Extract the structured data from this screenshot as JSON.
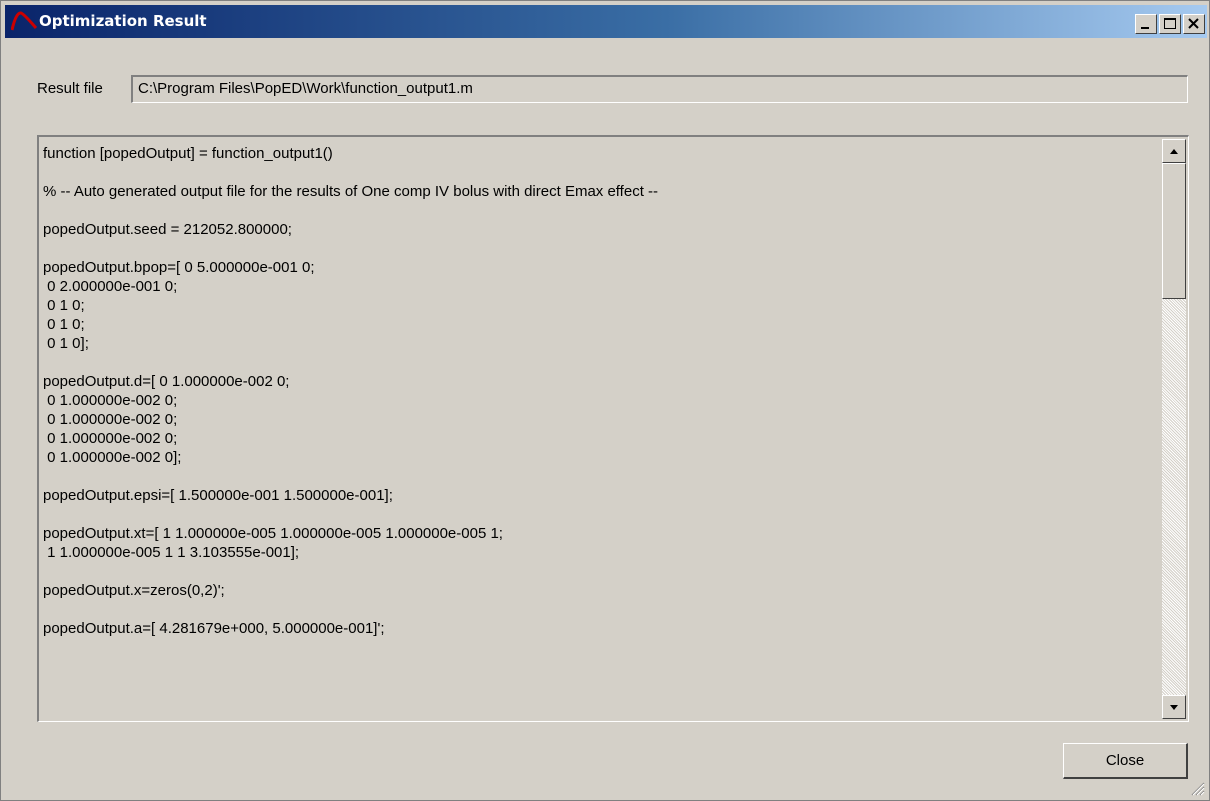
{
  "window": {
    "title": "Optimization Result",
    "controls": [
      "minimize-icon",
      "maximize-icon",
      "close-icon"
    ]
  },
  "result_file": {
    "label": "Result file",
    "value": "C:\\Program Files\\PopED\\Work\\function_output1.m"
  },
  "output_lines": [
    "function [popedOutput] = function_output1()",
    "",
    "% -- Auto generated output file for the results of One comp IV bolus with direct Emax effect --",
    "",
    "popedOutput.seed = 212052.800000;",
    "",
    "popedOutput.bpop=[ 0 5.000000e-001 0;",
    " 0 2.000000e-001 0;",
    " 0 1 0;",
    " 0 1 0;",
    " 0 1 0];",
    "",
    "popedOutput.d=[ 0 1.000000e-002 0;",
    " 0 1.000000e-002 0;",
    " 0 1.000000e-002 0;",
    " 0 1.000000e-002 0;",
    " 0 1.000000e-002 0];",
    "",
    "popedOutput.epsi=[ 1.500000e-001 1.500000e-001];",
    "",
    "popedOutput.xt=[ 1 1.000000e-005 1.000000e-005 1.000000e-005 1;",
    " 1 1.000000e-005 1 1 3.103555e-001];",
    "",
    "popedOutput.x=zeros(0,2)';",
    "",
    "popedOutput.a=[ 4.281679e+000, 5.000000e-001]';"
  ],
  "close_button": {
    "label": "Close"
  },
  "colors": {
    "title_start": "#0a246a",
    "title_end": "#a6caf0",
    "face": "#d4d0c8",
    "logo": "#cc0000"
  }
}
